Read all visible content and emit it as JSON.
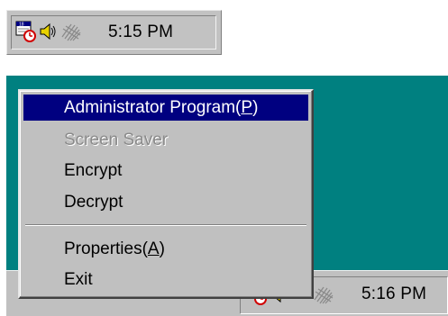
{
  "top_tray": {
    "icons": [
      "calendar-alarm-icon",
      "speaker-icon",
      "encrypt-mesh-icon"
    ],
    "clock": "5:15 PM"
  },
  "context_menu": {
    "items": [
      {
        "label": "Administrator Program(",
        "mnemonic": "P",
        "suffix": ")",
        "state": "selected"
      },
      {
        "label": "Screen Saver",
        "state": "disabled"
      },
      {
        "label": "Encrypt",
        "state": "normal"
      },
      {
        "label": "Decrypt",
        "state": "normal"
      },
      {
        "label": "Properties(",
        "mnemonic": "A",
        "suffix": ")",
        "state": "normal"
      },
      {
        "label": "Exit",
        "state": "normal"
      }
    ]
  },
  "taskbar": {
    "clock": "5:16 PM",
    "icons": [
      "calendar-alarm-icon",
      "speaker-icon",
      "encrypt-mesh-icon"
    ]
  },
  "colors": {
    "desktop": "#008080",
    "menu_highlight": "#000080",
    "face": "#c0c0c0"
  }
}
